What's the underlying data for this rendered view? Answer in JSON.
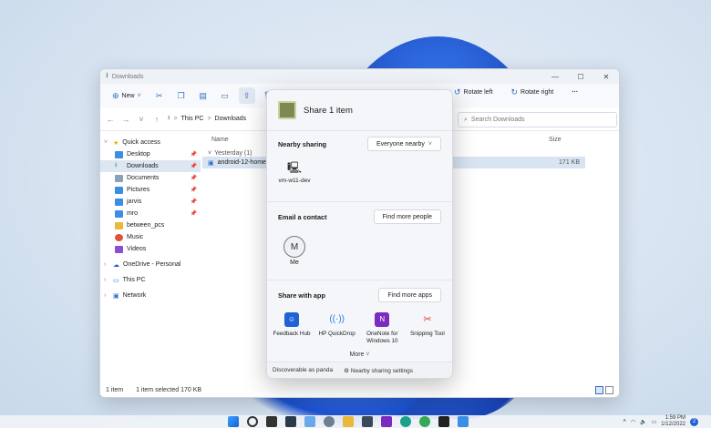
{
  "explorer": {
    "title": "Downloads",
    "toolbar": {
      "new_label": "New",
      "rotate_left": "Rotate left",
      "rotate_right": "Rotate right",
      "more": "···"
    },
    "address": {
      "crumb_root": "This PC",
      "crumb_sep": ">",
      "crumb_current": "Downloads"
    },
    "search_placeholder": "Search Downloads",
    "nav": {
      "quick_access": "Quick access",
      "items": [
        {
          "label": "Desktop",
          "color": "#3a8ee6"
        },
        {
          "label": "Downloads",
          "color": "#2f8f5a"
        },
        {
          "label": "Documents",
          "color": "#8aa1b8"
        },
        {
          "label": "Pictures",
          "color": "#3a8ee6"
        },
        {
          "label": "jarvis",
          "color": "#3a8ee6"
        },
        {
          "label": "mro",
          "color": "#3a8ee6"
        },
        {
          "label": "between_pcs",
          "color": "#e8b93a"
        },
        {
          "label": "Music",
          "color": "#e0533a"
        },
        {
          "label": "Videos",
          "color": "#8a4fd6"
        }
      ],
      "onedrive": "OneDrive - Personal",
      "this_pc": "This PC",
      "network": "Network"
    },
    "columns": {
      "name": "Name",
      "size": "Size"
    },
    "group": "Yesterday (1)",
    "file": {
      "name": "android-12-home-cu",
      "size": "171 KB"
    },
    "status": {
      "count": "1 item",
      "selected": "1 item selected  170 KB"
    }
  },
  "share": {
    "title": "Share 1 item",
    "nearby_label": "Nearby sharing",
    "nearby_option": "Everyone nearby",
    "device_name": "vm-w11-dev",
    "email_label": "Email a contact",
    "find_people": "Find more people",
    "avatar_initial": "M",
    "avatar_name": "Me",
    "apps_label": "Share with app",
    "find_apps": "Find more apps",
    "apps": [
      {
        "name": "Feedback Hub",
        "color": "#1f62d6"
      },
      {
        "name": "HP QuickDrop",
        "color": "#2a7de1"
      },
      {
        "name": "OneNote for Windows 10",
        "color": "#7b2bbf"
      },
      {
        "name": "Snipping Tool",
        "color": "#d8452e"
      }
    ],
    "more": "More",
    "footer_discoverable": "Discoverable as panda",
    "footer_settings": "Nearby sharing settings"
  },
  "taskbar": {
    "time": "1:59 PM",
    "date": "1/12/2022",
    "notifications": "2"
  }
}
